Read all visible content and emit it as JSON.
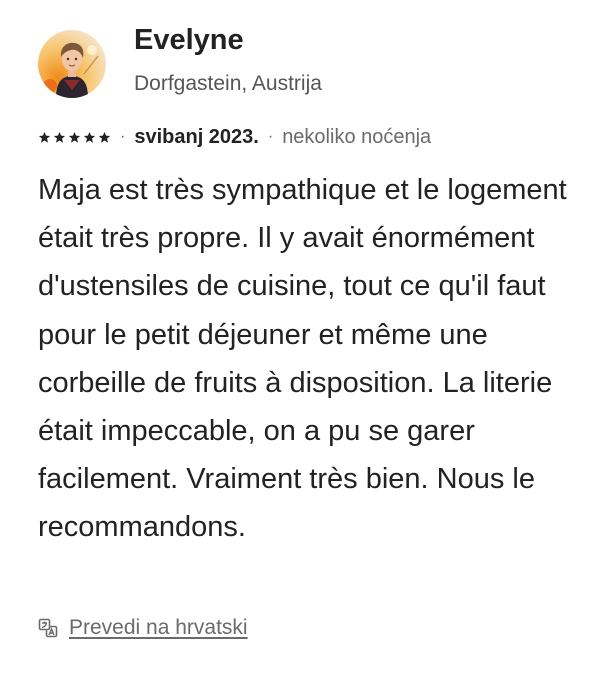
{
  "reviewer": {
    "name": "Evelyne",
    "location": "Dorfgastein, Austrija",
    "avatar_icon": "reviewer-avatar-photo"
  },
  "rating": {
    "stars": 5,
    "max_stars": 5,
    "star_icon": "star-icon",
    "star_color": "#222222"
  },
  "meta": {
    "date": "svibanj 2023.",
    "stay_length": "nekoliko noćenja",
    "separator": "·"
  },
  "review": {
    "text": "Maja est très sympathique et le logement était très propre. Il y avait énormément d'ustensiles de cuisine, tout ce qu'il faut pour le petit déjeuner et même une corbeille de fruits à disposition. La literie était impeccable, on a pu se garer facilement. Vraiment très bien. Nous le recommandons."
  },
  "translate": {
    "label": "Prevedi na hrvatski",
    "icon": "translate-icon"
  }
}
